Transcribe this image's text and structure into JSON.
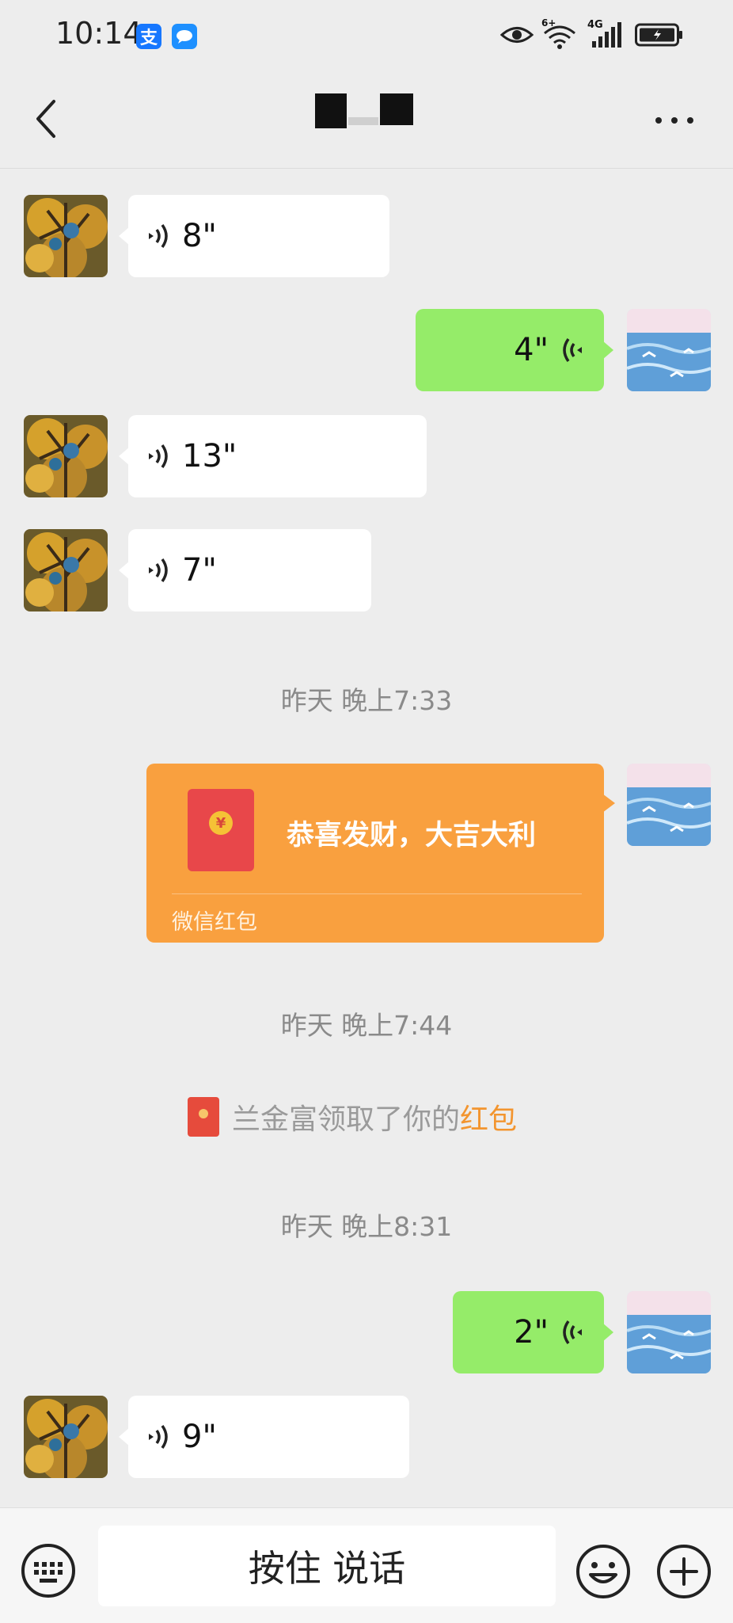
{
  "status_bar": {
    "time": "10:14",
    "alipay_icon": "支",
    "network_label": "4G",
    "wifi_label": "6+"
  },
  "header": {
    "title": ""
  },
  "messages": [
    {
      "direction": "in",
      "type": "voice",
      "duration": "8\""
    },
    {
      "direction": "out",
      "type": "voice",
      "duration": "4\""
    },
    {
      "direction": "in",
      "type": "voice",
      "duration": "13\""
    },
    {
      "direction": "in",
      "type": "voice",
      "duration": "7\""
    },
    {
      "type": "timestamp",
      "text": "昨天 晚上7:33"
    },
    {
      "direction": "out",
      "type": "red_packet",
      "greeting": "恭喜发财，大吉大利",
      "label": "微信红包"
    },
    {
      "type": "timestamp",
      "text": "昨天 晚上7:44"
    },
    {
      "type": "system",
      "text": "兰金富领取了你的",
      "link": "红包"
    },
    {
      "type": "timestamp",
      "text": "昨天 晚上8:31"
    },
    {
      "direction": "out",
      "type": "voice",
      "duration": "2\""
    },
    {
      "direction": "in",
      "type": "voice",
      "duration": "9\""
    }
  ],
  "red_packet_coin": "¥",
  "bottom_bar": {
    "hold_to_talk_label": "按住 说话"
  },
  "icons": [
    "back-arrow-icon",
    "more-dots-icon",
    "voice-wave-icon",
    "keyboard-icon",
    "emoji-icon",
    "plus-icon",
    "red-packet-icon"
  ],
  "colors": {
    "background": "#ededed",
    "outgoing_bubble": "#95ec69",
    "incoming_bubble": "#ffffff",
    "red_packet": "#f9a03f",
    "notice_link": "#f3952f"
  }
}
